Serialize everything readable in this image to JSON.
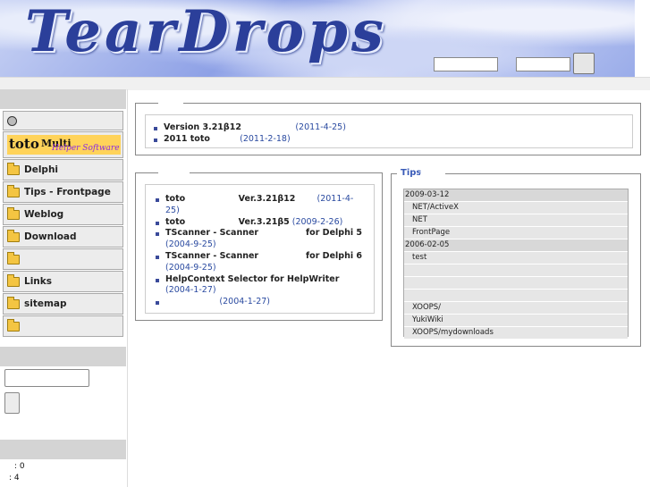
{
  "header": {
    "title": "TearDrops"
  },
  "sidebar": {
    "logo": {
      "main": "toto",
      "multi": "Multi",
      "sub": "Helper Software"
    },
    "menu": [
      {
        "label": "Delphi"
      },
      {
        "label": "Tips - Frontpage"
      },
      {
        "label": "Weblog"
      },
      {
        "label": "Download"
      },
      {
        "label": ""
      },
      {
        "label": "Links"
      },
      {
        "label": "sitemap"
      },
      {
        "label": ""
      }
    ],
    "counter": {
      "line1": ": 0",
      "line2": ": 4"
    }
  },
  "news": {
    "items": [
      {
        "text": "Version 3.21β12",
        "date": "(2011-4-25)"
      },
      {
        "text": "2011      toto",
        "date": "(2011-2-18)"
      }
    ]
  },
  "updates": {
    "items": [
      {
        "text": "toto                  Ver.3.21β12",
        "date": "(2011-4-25)"
      },
      {
        "text": "toto                  Ver.3.21β5",
        "date": "(2009-2-26)"
      },
      {
        "text": "TScanner - Scanner                for Delphi 5",
        "date": "(2004-9-25)"
      },
      {
        "text": "TScanner - Scanner                for Delphi 6",
        "date": "(2004-9-25)"
      },
      {
        "text": "HelpContext Selector for HelpWriter",
        "date": "(2004-1-27)"
      },
      {
        "text": "",
        "date": "(2004-1-27)"
      }
    ]
  },
  "tips": {
    "title": "Tips",
    "rows": [
      {
        "kind": "top",
        "text": "2009-03-12"
      },
      {
        "kind": "sub",
        "text": "NET/ActiveX"
      },
      {
        "kind": "sub",
        "text": "NET"
      },
      {
        "kind": "sub",
        "text": "FrontPage"
      },
      {
        "kind": "top",
        "text": "2006-02-05"
      },
      {
        "kind": "sub",
        "text": "test"
      },
      {
        "kind": "sub",
        "text": ""
      },
      {
        "kind": "sub",
        "text": ""
      },
      {
        "kind": "sub",
        "text": ""
      },
      {
        "kind": "sub",
        "text": "XOOPS/"
      },
      {
        "kind": "sub",
        "text": "YukiWiki"
      },
      {
        "kind": "sub",
        "text": "XOOPS/mydownloads"
      }
    ]
  }
}
